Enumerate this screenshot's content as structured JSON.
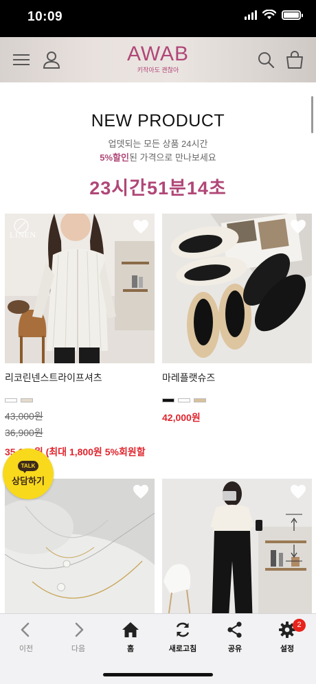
{
  "status_bar": {
    "time": "10:09"
  },
  "header": {
    "logo": "AWAB",
    "logo_sub": "키작아도 괜찮아"
  },
  "section": {
    "title": "NEW PRODUCT",
    "desc_line1": "업뎃되는 모든 상품 24시간",
    "desc_highlight": "5%할인",
    "desc_line2_rest": "된 가격으로 만나보세요",
    "countdown": "23시간51분14초"
  },
  "products": [
    {
      "name": "리코린넨스트라이프셔츠",
      "badge_text": "LINEN",
      "swatches": [
        "#ffffff",
        "#e6dccb"
      ],
      "price_original_1": "43,000원",
      "price_original_2": "36,900원",
      "price_sale": "35,100원 (최대 1,800원 5%회원할인)"
    },
    {
      "name": "마레플랫슈즈",
      "swatches": [
        "#111111",
        "#ffffff",
        "#d9c29b"
      ],
      "price_sale": "42,000원"
    },
    {
      "name": "",
      "image": "pearl-necklace"
    },
    {
      "name": "",
      "image": "woman-black-pants"
    }
  ],
  "talk_button": {
    "bubble": "TALK",
    "label": "상담하기"
  },
  "bottom_nav": [
    {
      "label": "이전",
      "icon": "chevron-left-icon",
      "enabled": false
    },
    {
      "label": "다음",
      "icon": "chevron-right-icon",
      "enabled": false
    },
    {
      "label": "홈",
      "icon": "home-icon",
      "enabled": true
    },
    {
      "label": "새로고침",
      "icon": "refresh-icon",
      "enabled": true
    },
    {
      "label": "공유",
      "icon": "share-icon",
      "enabled": true
    },
    {
      "label": "설정",
      "icon": "gear-icon",
      "enabled": true,
      "badge": "2"
    }
  ],
  "colors": {
    "brand": "#b04777",
    "sale": "#e0252d",
    "kakao": "#f8d91c"
  }
}
